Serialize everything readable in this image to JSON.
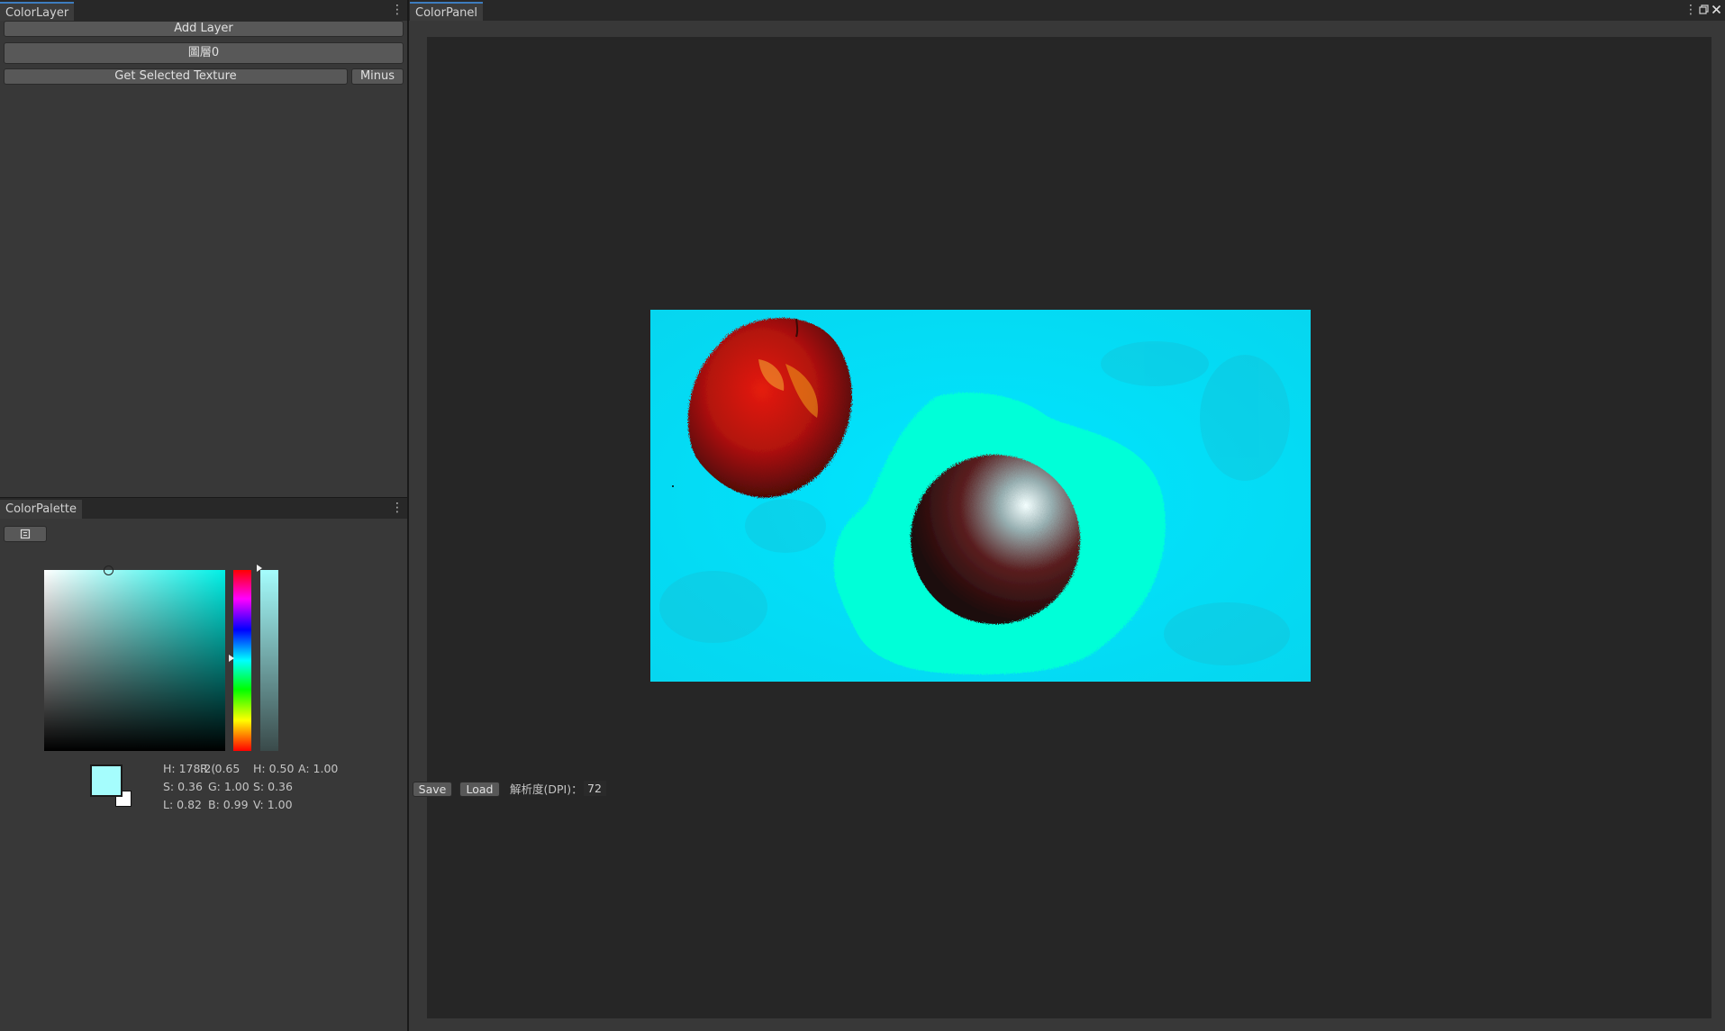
{
  "color_layer": {
    "tab_title": "ColorLayer",
    "add_layer_label": "Add Layer",
    "layer_item_label": "圖層0",
    "get_texture_label": "Get Selected Texture",
    "minus_label": "Minus"
  },
  "color_palette": {
    "tab_title": "ColorPalette",
    "sv_hue_color": "#00f0e6",
    "selected_color": "#a5fdfd",
    "secondary_color": "#ffffff",
    "values": {
      "row1": [
        "H: 178.2(",
        "R: 0.65",
        "H: 0.50",
        "A: 1.00"
      ],
      "row2": [
        "S: 0.36",
        "G: 1.00",
        "S: 0.36"
      ],
      "row3": [
        "L: 0.82",
        "B: 0.99",
        "V: 1.00"
      ]
    }
  },
  "color_panel": {
    "tab_title": "ColorPanel",
    "save_label": "Save",
    "load_label": "Load",
    "dpi_label": "解析度(DPI)：",
    "dpi_value": "72",
    "canvas_bg_color": "#00e6ff",
    "glow_color": "#00ffd8"
  },
  "window_icons": [
    "kebab-menu-icon",
    "maximize-icon",
    "close-icon"
  ]
}
